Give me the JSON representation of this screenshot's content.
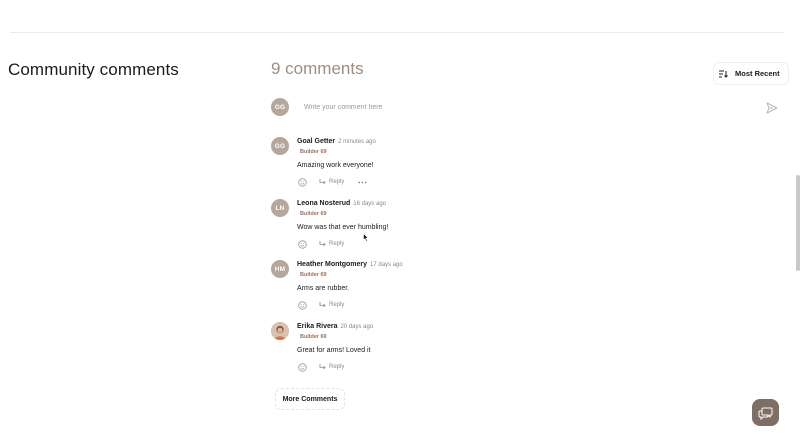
{
  "section": {
    "title": "Community comments"
  },
  "header": {
    "count": "9 comments",
    "sort_label": "Most Recent"
  },
  "composer": {
    "avatar_initials": "GG",
    "placeholder": "Write your comment here"
  },
  "comments": [
    {
      "initials": "GG",
      "name": "Goal Getter",
      "time": "2 minutes ago",
      "badge": "Builder 69",
      "text": "Amazing work everyone!",
      "reply_label": "Reply",
      "has_more": true
    },
    {
      "initials": "LN",
      "name": "Leona Nosterud",
      "time": "16 days ago",
      "badge": "Builder 69",
      "text": "Wow was that ever humbling!",
      "reply_label": "Reply",
      "has_more": false
    },
    {
      "initials": "HM",
      "name": "Heather Montgomery",
      "time": "17 days ago",
      "badge": "Builder 69",
      "text": "Arms are rubber.",
      "reply_label": "Reply",
      "has_more": false
    },
    {
      "initials": "",
      "name": "Erika Rivera",
      "time": "20 days ago",
      "badge": "Builder 69",
      "text": "Great for arms! Loved it",
      "reply_label": "Reply",
      "has_more": false,
      "photo_avatar": true
    }
  ],
  "more_comments_label": "More Comments",
  "colors": {
    "accent": "#a08d7f",
    "avatar": "#b6a79c",
    "badge": "#9b6f55",
    "support": "#7e6e64"
  },
  "icons": {
    "sort": "sort-lines-icon",
    "send": "send-arrow-icon",
    "reaction": "smiley-icon",
    "reply": "reply-arrow-icon",
    "more": "ellipsis-icon",
    "support": "chat-bubble-icon"
  }
}
